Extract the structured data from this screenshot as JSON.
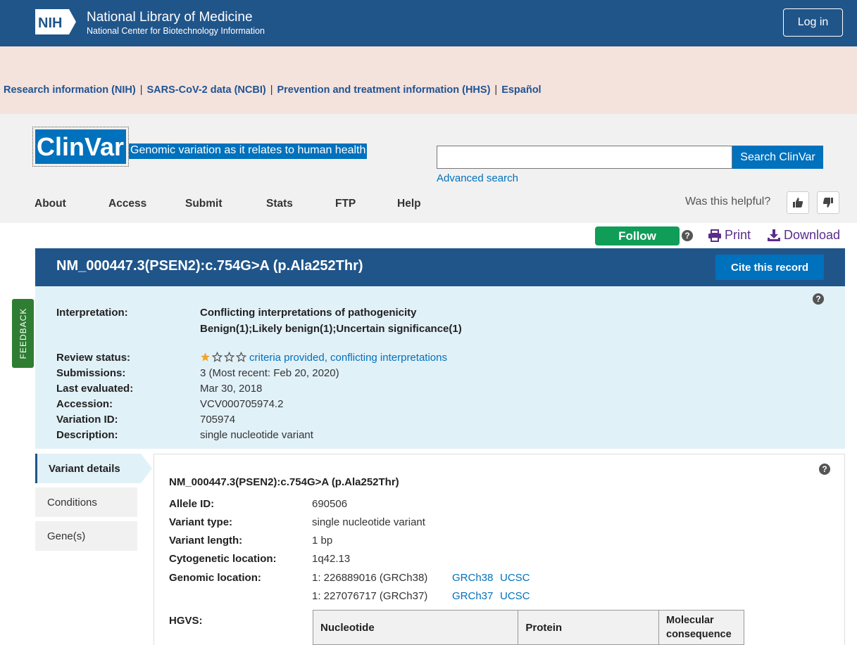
{
  "nih": {
    "logo_text": "NIH",
    "title": "National Library of Medicine",
    "subtitle": "National Center for Biotechnology Information",
    "login": "Log in"
  },
  "covid_banner": {
    "links": [
      "Research information (NIH)",
      "SARS-CoV-2 data (NCBI)",
      "Prevention and treatment information (HHS)",
      "Español"
    ],
    "separator": "|"
  },
  "clinvar": {
    "logo": "ClinVar",
    "tagline": "Genomic variation as it relates to human health",
    "search_button": "Search ClinVar",
    "search_value": "",
    "advanced_search": "Advanced search",
    "nav": [
      "About",
      "Access",
      "Submit",
      "Stats",
      "FTP",
      "Help"
    ],
    "helpful": "Was this helpful?"
  },
  "actions": {
    "follow": "Follow",
    "print": "Print",
    "download": "Download"
  },
  "record": {
    "title": "NM_000447.3(PSEN2):c.754G>A (p.Ala252Thr)",
    "cite": "Cite this record"
  },
  "summary": {
    "interpretation_label": "Interpretation:",
    "interpretation_line1": "Conflicting interpretations of pathogenicity",
    "interpretation_line2": "Benign(1);Likely benign(1);Uncertain significance(1)",
    "review_status_label": "Review status:",
    "review_status": "criteria provided, conflicting interpretations",
    "review_stars": 1,
    "review_stars_max": 4,
    "submissions_label": "Submissions:",
    "submissions": "3 (Most recent: Feb 20, 2020)",
    "last_evaluated_label": "Last evaluated:",
    "last_evaluated": "Mar 30, 2018",
    "accession_label": "Accession:",
    "accession": "VCV000705974.2",
    "variation_id_label": "Variation ID:",
    "variation_id": "705974",
    "description_label": "Description:",
    "description": "single nucleotide variant"
  },
  "feedback": "FEEDBACK",
  "side_tabs": [
    "Variant details",
    "Conditions",
    "Gene(s)"
  ],
  "details": {
    "title": "NM_000447.3(PSEN2):c.754G>A (p.Ala252Thr)",
    "allele_id_label": "Allele ID:",
    "allele_id": "690506",
    "variant_type_label": "Variant type:",
    "variant_type": "single nucleotide variant",
    "variant_length_label": "Variant length:",
    "variant_length": "1 bp",
    "cytogenetic_label": "Cytogenetic location:",
    "cytogenetic": "1q42.13",
    "genomic_label": "Genomic location:",
    "genomic_38": "1: 226889016 (GRCh38)",
    "genomic_38_link": "GRCh38",
    "genomic_38_ucsc": "UCSC",
    "genomic_37": "1: 227076717 (GRCh37)",
    "genomic_37_link": "GRCh37",
    "genomic_37_ucsc": "UCSC",
    "hgvs_label": "HGVS:",
    "hgvs_columns": [
      "Nucleotide",
      "Protein",
      "Molecular consequence"
    ]
  },
  "colors": {
    "nih_blue": "#20558a",
    "clinvar_blue": "#0071bc",
    "follow_green": "#0f9d58",
    "summary_bg": "#e1f1f8",
    "banner_bg": "#f4e2dc",
    "star_gold": "#f5a623"
  }
}
